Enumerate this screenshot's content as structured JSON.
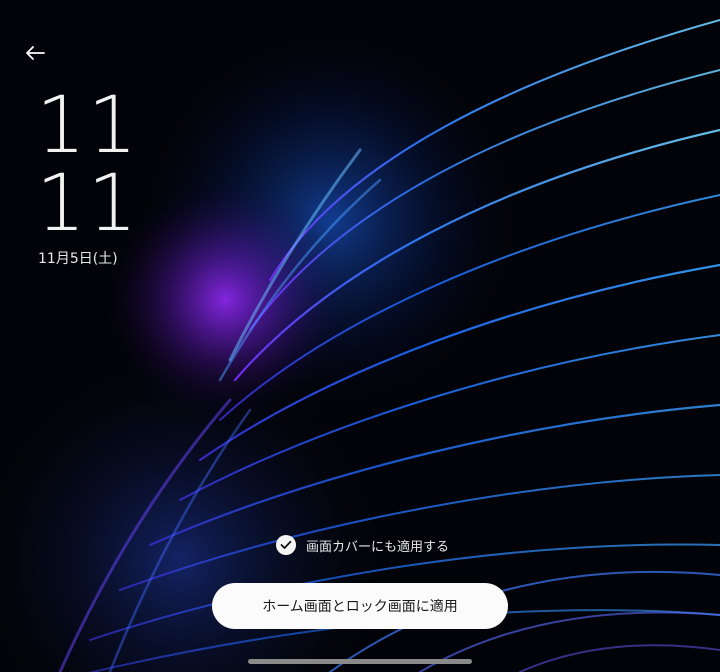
{
  "lockscreen": {
    "clock_hours": "11",
    "clock_minutes": "11",
    "date": "11月5日(土)"
  },
  "cover_option": {
    "label": "画面カバーにも適用する",
    "checked": true
  },
  "apply_button": {
    "label": "ホーム画面とロック画面に適用"
  },
  "icons": {
    "back": "arrow-left-icon",
    "check": "check-icon"
  },
  "colors": {
    "background": "#020308",
    "accent_blue": "#2f7dff",
    "accent_purple": "#8a2be2",
    "button_bg": "#fbfbfb"
  }
}
